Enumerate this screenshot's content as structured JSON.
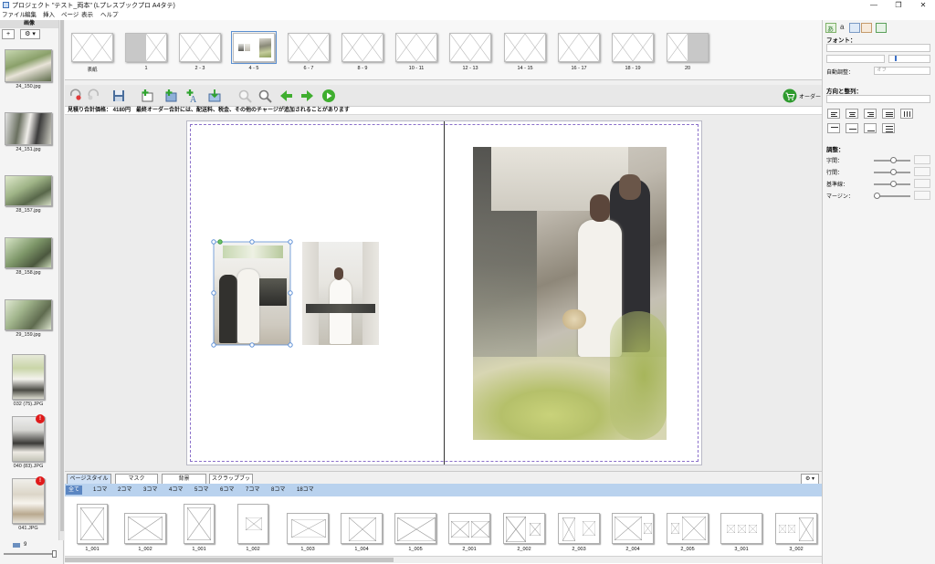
{
  "window": {
    "title": "プロジェクト \"テスト_両本\" (Lプレスブックプロ A4タテ)",
    "minimize_icon": "minimize-icon",
    "maximize_icon": "restore-icon",
    "close_icon": "close-icon"
  },
  "menu": [
    "ファイル",
    "編集",
    "挿入",
    "ページ",
    "表示",
    "ヘルプ"
  ],
  "left_panel": {
    "header": "画像",
    "add_label": "+",
    "settings_label": "⚙ ▾",
    "images": [
      {
        "name": "24_150.jpg",
        "badge": ""
      },
      {
        "name": "24_151.jpg",
        "badge": ""
      },
      {
        "name": "28_157.jpg",
        "badge": ""
      },
      {
        "name": "28_158.jpg",
        "badge": ""
      },
      {
        "name": "29_159.jpg",
        "badge": ""
      },
      {
        "name": "032 (75).JPG",
        "badge": ""
      },
      {
        "name": "040 (83).JPG",
        "badge": "!"
      },
      {
        "name": "041.JPG",
        "badge": "!"
      }
    ],
    "count": "9"
  },
  "page_strip": {
    "spreads": [
      "表紙",
      "1",
      "2 - 3",
      "4 - 5",
      "6 - 7",
      "8 - 9",
      "10 - 11",
      "12 - 13",
      "14 - 15",
      "16 - 17",
      "18 - 19",
      "20"
    ],
    "selected": "4 - 5"
  },
  "toolbar": {
    "icons": [
      "undo-icon",
      "redo-icon",
      "save-icon",
      "add-page-icon",
      "add-image-icon",
      "add-text-icon",
      "export-icon",
      "zoom-out-icon",
      "zoom-in-icon",
      "previous-page-icon",
      "next-page-icon",
      "play-icon"
    ],
    "order_label": "オーダー",
    "order_icon": "cart-icon"
  },
  "price_bar": "見積り合計価格： 4180円　最終オーダー合計には、配送料、税金、その他のチャージが追加されることがあります",
  "bottom_tabs": {
    "tabs": [
      "ページスタイル",
      "マスク",
      "背景",
      "スクラップブック"
    ],
    "active": "ページスタイル",
    "settings_label": "⚙ ▾"
  },
  "filters": {
    "items": [
      "全て",
      "1コマ",
      "2コマ",
      "3コマ",
      "4コマ",
      "5コマ",
      "6コマ",
      "7コマ",
      "8コマ",
      "18コマ"
    ],
    "active": "全て"
  },
  "layouts": [
    "1_001",
    "1_002",
    "1_001",
    "1_002",
    "1_003",
    "1_004",
    "1_005",
    "2_001",
    "2_002",
    "2_003",
    "2_004",
    "2_005",
    "3_001",
    "3_002"
  ],
  "right_panel": {
    "tool_icons": [
      "font-tool-icon",
      "text-tool-icon",
      "image-tool-icon",
      "shape-tool-icon",
      "layout-tool-icon"
    ],
    "font_label": "フォント：",
    "auto_adjust_label": "自動調整：",
    "auto_adjust_value": "オフ",
    "direction_label": "方向と整列：",
    "adjust_label": "調整：",
    "adjust_items": [
      "字間：",
      "行間：",
      "基準線：",
      "マージン："
    ]
  }
}
